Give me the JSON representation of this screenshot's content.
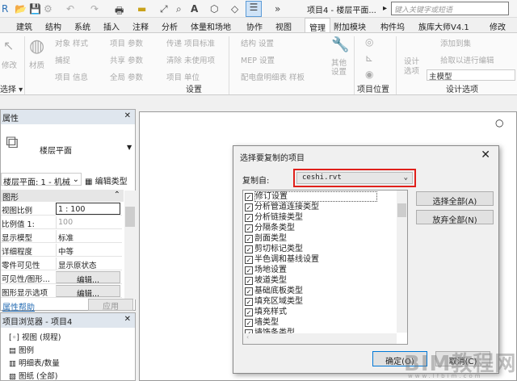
{
  "qat": {
    "title": "项目4 - 楼层平面...",
    "search_placeholder": "键入关键字或短语"
  },
  "tabs": [
    "建筑",
    "结构",
    "系统",
    "插入",
    "注释",
    "分析",
    "体量和场地",
    "协作",
    "视图",
    "管理",
    "附加模块",
    "构件坞",
    "族库大师V4.1",
    "修改"
  ],
  "active_tab": "管理",
  "ribbon": {
    "modify": "修改",
    "material": "材质",
    "settings_items": [
      "对象 样式",
      "项目 参数",
      "传递 项目标准",
      "捕捉",
      "共享 参数",
      "清除 未使用项",
      "项目 信息",
      "全局 参数",
      "项目 单位",
      "结构 设置",
      "MEP 设置",
      "配电盘明细表 样板",
      "其他 设置"
    ],
    "design_items": [
      "设计 选项",
      "添加到集",
      "拾取以进行编辑",
      "主模型"
    ],
    "panels": {
      "select": "选择",
      "settings": "设置",
      "location": "项目位置",
      "design_options": "设计选项"
    }
  },
  "properties": {
    "title": "属性",
    "type_name": "楼层平面",
    "view_selector": "楼层平面: 1 - 机械",
    "edit_type": "编辑类型",
    "group": "图形",
    "rows": [
      {
        "k": "视图比例",
        "v": "1 : 100"
      },
      {
        "k": "比例值 1:",
        "v": "100"
      },
      {
        "k": "显示模型",
        "v": "标准"
      },
      {
        "k": "详细程度",
        "v": "中等"
      },
      {
        "k": "零件可见性",
        "v": "显示原状态"
      },
      {
        "k": "可见性/图形...",
        "v": "编辑..."
      },
      {
        "k": "图形显示选项",
        "v": "编辑..."
      }
    ],
    "help": "属性帮助",
    "apply": "应用"
  },
  "browser": {
    "title": "项目浏览器 - 项目4",
    "items": [
      "视图 (规程)",
      "图例",
      "明细表/数量",
      "图纸 (全部)"
    ]
  },
  "dialog": {
    "title": "选择要复制的项目",
    "copy_from_label": "复制自:",
    "copy_from_value": "ceshi.rvt",
    "items": [
      "修订设置",
      "分析管道连接类型",
      "分析链接类型",
      "分隔条类型",
      "剖面类型",
      "剪切标记类型",
      "半色调和基线设置",
      "场地设置",
      "坡道类型",
      "基础底板类型",
      "填充区域类型",
      "填充样式",
      "墙类型",
      "墙饰条类型"
    ],
    "select_all": "选择全部(A)",
    "deselect_all": "放弃全部(N)",
    "ok": "确定(O)",
    "cancel": "取消(C)"
  },
  "watermark": {
    "text": "BIM教程网",
    "url": "www.lfbim.com"
  },
  "colors": {
    "highlight": "#e0201b",
    "accent": "#3b7fc4"
  }
}
